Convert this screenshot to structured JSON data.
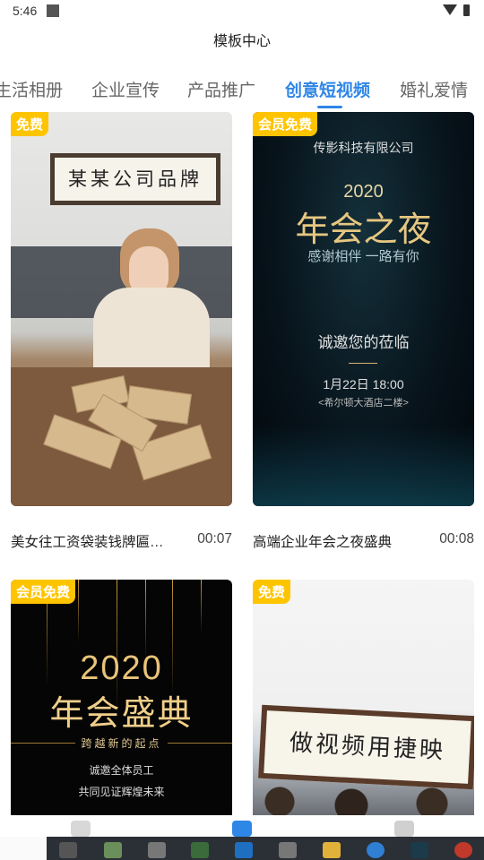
{
  "status_bar": {
    "time": "5:46"
  },
  "header": {
    "title": "模板中心"
  },
  "tabs": [
    {
      "label": "生活相册",
      "active": false
    },
    {
      "label": "企业宣传",
      "active": false
    },
    {
      "label": "产品推广",
      "active": false
    },
    {
      "label": "创意短视频",
      "active": true
    },
    {
      "label": "婚礼爱情",
      "active": false
    }
  ],
  "cards": [
    {
      "badge": "免费",
      "name": "美女往工资袋装钱牌匾…",
      "duration": "00:07",
      "thumb": {
        "plaque": "某某公司品牌"
      }
    },
    {
      "badge": "会员免费",
      "name": "高端企业年会之夜盛典",
      "duration": "00:08",
      "thumb": {
        "company": "传影科技有限公司",
        "year": "2020",
        "title": "年会之夜",
        "thanks": "感谢相伴 一路有你",
        "invite": "诚邀您的莅临",
        "date": "1月22日 18:00",
        "venue": "<希尔顿大酒店二楼>"
      }
    },
    {
      "badge": "会员免费",
      "thumb": {
        "year": "2020",
        "title": "年会盛典",
        "slogan": "跨越新的起点",
        "line1": "诚邀全体员工",
        "line2": "共同见证辉煌未来"
      }
    },
    {
      "badge": "免费",
      "thumb": {
        "plaque": "做视频用捷映"
      }
    }
  ],
  "colors": {
    "accent": "#2e86e6",
    "badge": "#ffc400"
  },
  "bottom_nav": {
    "icons": [
      "heart-icon",
      "template-icon",
      "profile-icon"
    ]
  }
}
